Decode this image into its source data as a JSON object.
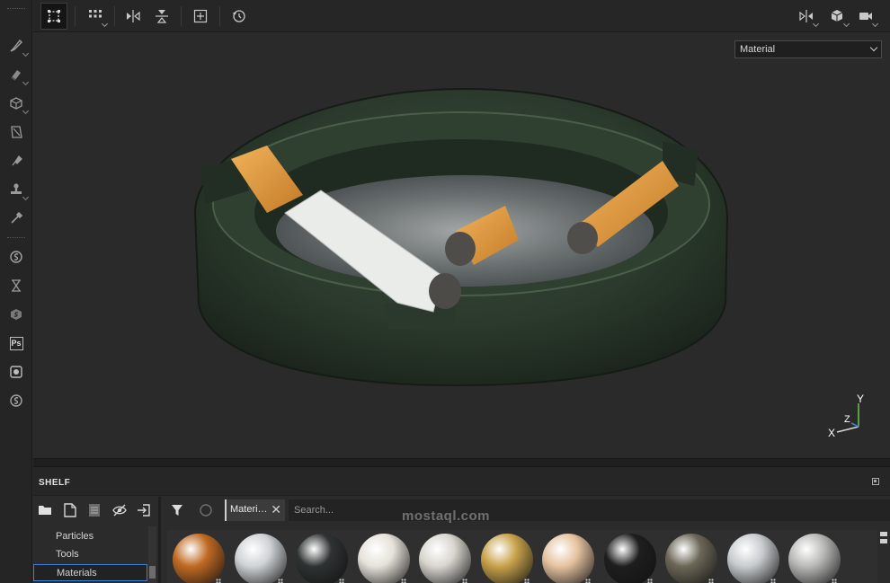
{
  "viewport": {
    "channel_select": {
      "value": "Material"
    },
    "axis_gizmo": {
      "x_label": "X",
      "y_label": "Y",
      "z_label": "Z"
    }
  },
  "toolbar": {
    "tools": [
      {
        "name": "selection-tool-icon"
      },
      {
        "name": "grid-menu-icon"
      },
      {
        "name": "mirror-horizontal-icon"
      },
      {
        "name": "mirror-vertical-icon"
      },
      {
        "name": "fit-view-icon"
      },
      {
        "name": "reset-view-icon"
      }
    ],
    "right_tools": [
      {
        "name": "split-view-icon"
      },
      {
        "name": "3d-cube-icon"
      },
      {
        "name": "camera-icon"
      }
    ]
  },
  "left_tools": [
    "brush-icon",
    "eraser-icon",
    "projection-icon",
    "polygon-fill-icon",
    "smudge-icon",
    "clone-stamp-icon",
    "color-picker-icon",
    "bake-icon",
    "hourglass-icon",
    "substance-icon",
    "photoshop-icon",
    "render-icon",
    "substance-share-icon"
  ],
  "shelf": {
    "title": "SHELF",
    "tree": [
      {
        "label": "Particles"
      },
      {
        "label": "Tools"
      },
      {
        "label": "Materials",
        "selected": true
      }
    ],
    "filter_tag": "Materi…",
    "search": {
      "placeholder": "Search...",
      "value": ""
    },
    "materials": [
      {
        "name": "copper-perforated",
        "color": "#c06a22"
      },
      {
        "name": "chrome",
        "color": "#cfd3d6"
      },
      {
        "name": "black-plastic",
        "color": "#2e3232"
      },
      {
        "name": "leaf-decal",
        "color": "#e6e2da"
      },
      {
        "name": "pearl",
        "color": "#d9d6cf"
      },
      {
        "name": "gold",
        "color": "#c8a24a"
      },
      {
        "name": "skin",
        "color": "#e5c3a0"
      },
      {
        "name": "black-glossy",
        "color": "#1e1e1e"
      },
      {
        "name": "olive-metal",
        "color": "#6b6657"
      },
      {
        "name": "steel",
        "color": "#c8ccce"
      },
      {
        "name": "concrete",
        "color": "#b9bab8"
      }
    ],
    "watermark": "mostaql.com"
  }
}
